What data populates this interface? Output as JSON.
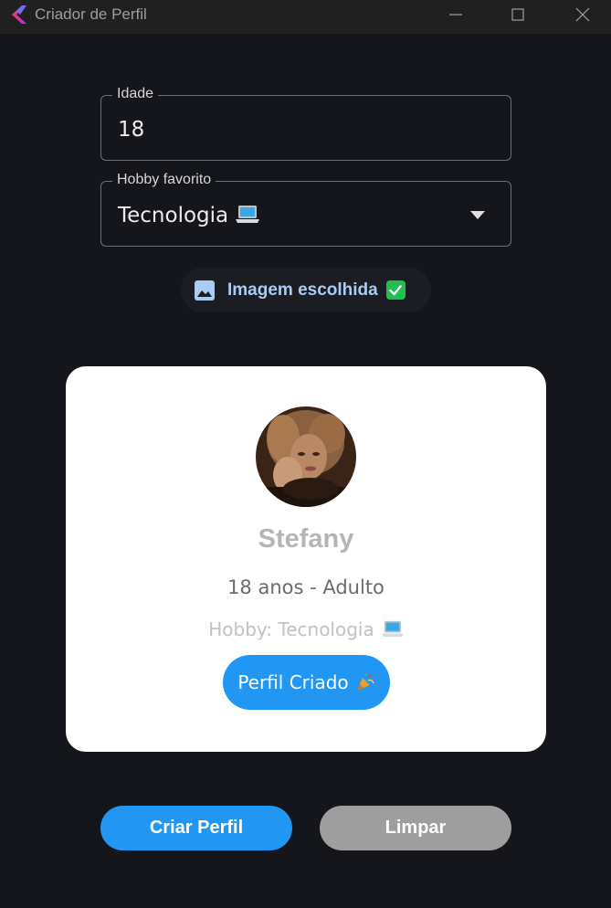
{
  "window": {
    "title": "Criador de Perfil"
  },
  "form": {
    "age": {
      "label": "Idade",
      "value": "18"
    },
    "hobby": {
      "label": "Hobby favorito",
      "value": "Tecnologia"
    },
    "image_chip": {
      "label": "Imagem escolhida",
      "icon": "image-icon",
      "status_icon": "check-mark-icon"
    }
  },
  "profile_card": {
    "name": "Stefany",
    "age_line": "18 anos - Adulto",
    "hobby_line": "Hobby: Tecnologia",
    "status_label": "Perfil Criado"
  },
  "actions": {
    "create_label": "Criar Perfil",
    "clear_label": "Limpar"
  },
  "colors": {
    "background": "#14161b",
    "accent": "#2196f3",
    "secondary_button": "#9e9e9e",
    "chip_text": "#aacbf6",
    "card": "#ffffff"
  }
}
